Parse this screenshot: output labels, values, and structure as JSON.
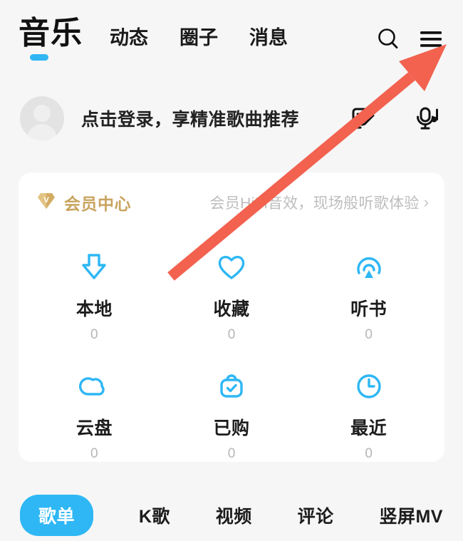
{
  "app": {
    "brand": "音乐",
    "accent_blue": "#2eb7f4",
    "gold": "#c9a45f",
    "annotation_red": "#f2624f",
    "page_bg": "#f6f6f6",
    "card_bg": "#ffffff"
  },
  "topnav": {
    "items": [
      {
        "label": "动态"
      },
      {
        "label": "圈子"
      },
      {
        "label": "消息"
      }
    ],
    "search_icon": "search-icon",
    "menu_icon": "hamburger-menu-icon"
  },
  "login": {
    "text": "点击登录，享精准歌曲推荐",
    "avatar": "default-avatar",
    "actions": [
      {
        "icon": "edit-note-icon"
      },
      {
        "icon": "karaoke-mic-icon"
      }
    ]
  },
  "vip": {
    "badge_letter": "V",
    "title": "会员中心",
    "subtitle": "会员HiFi音效，现场般听歌体验",
    "chevron": "›"
  },
  "grid": {
    "items": [
      {
        "label": "本地",
        "count": "0",
        "icon": "download-arrow-icon"
      },
      {
        "label": "收藏",
        "count": "0",
        "icon": "heart-icon"
      },
      {
        "label": "听书",
        "count": "0",
        "icon": "audiobook-icon"
      },
      {
        "label": "云盘",
        "count": "0",
        "icon": "cloud-icon"
      },
      {
        "label": "已购",
        "count": "0",
        "icon": "purchased-bag-check-icon"
      },
      {
        "label": "最近",
        "count": "0",
        "icon": "clock-icon"
      }
    ]
  },
  "tabs": {
    "items": [
      {
        "label": "歌单",
        "active": true
      },
      {
        "label": "K歌",
        "active": false
      },
      {
        "label": "视频",
        "active": false
      },
      {
        "label": "评论",
        "active": false
      },
      {
        "label": "竖屏MV",
        "active": false
      }
    ]
  },
  "annotation": {
    "type": "arrow",
    "points_to": "hamburger-menu-icon"
  }
}
